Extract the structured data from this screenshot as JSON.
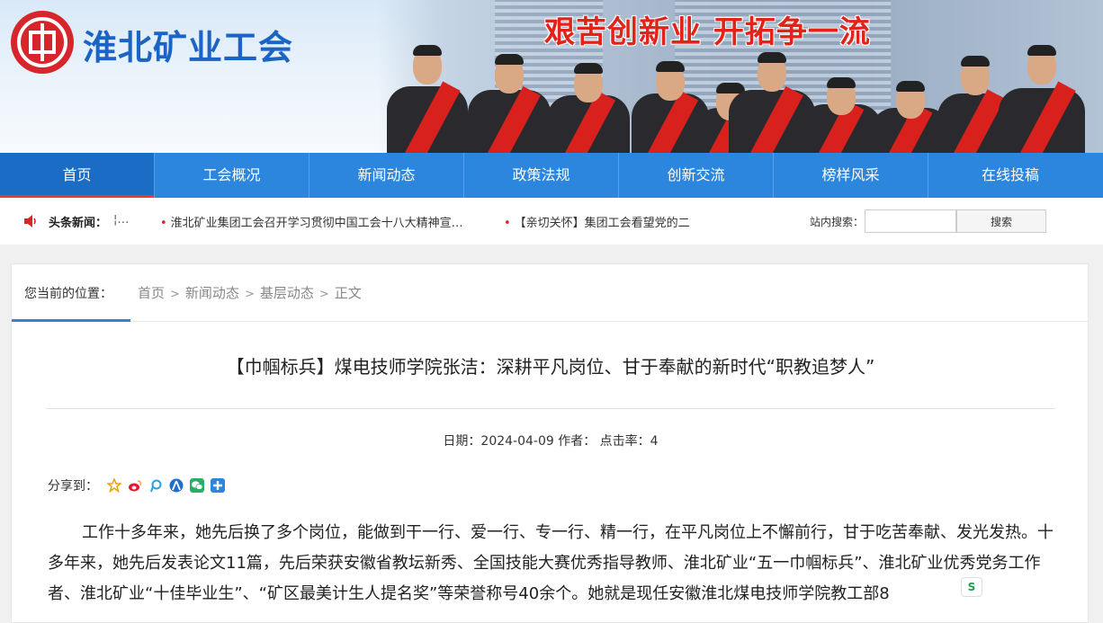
{
  "site": {
    "name": "淮北矿业工会",
    "slogan": "艰苦创新业 开拓争一流"
  },
  "nav": [
    {
      "label": "首页",
      "active": true
    },
    {
      "label": "工会概况",
      "active": false
    },
    {
      "label": "新闻动态",
      "active": false
    },
    {
      "label": "政策法规",
      "active": false
    },
    {
      "label": "创新交流",
      "active": false
    },
    {
      "label": "榜样风采",
      "active": false
    },
    {
      "label": "在线投稿",
      "active": false
    }
  ],
  "ticker": {
    "label": "头条新闻：",
    "dots": "¦…",
    "bullet": "•",
    "items": [
      "淮北矿业集团工会召开学习贯彻中国工会十八大精神宣…",
      "【亲切关怀】集团工会看望党的二"
    ]
  },
  "search": {
    "label": "站内搜索：",
    "value": "",
    "button": "搜索"
  },
  "breadcrumb": {
    "label": "您当前的位置：",
    "items": [
      "首页",
      "新闻动态",
      "基层动态",
      "正文"
    ],
    "separator": ">"
  },
  "article": {
    "title": "【巾帼标兵】煤电技师学院张洁：深耕平凡岗位、甘于奉献的新时代“职教追梦人”",
    "meta": "日期：2024-04-09 作者：  点击率：4",
    "share_label": "分享到：",
    "share_icons": [
      "qzone-icon",
      "weibo-icon",
      "tencent-weibo-icon",
      "renren-icon",
      "wechat-icon",
      "more-share-icon"
    ],
    "body": "工作十多年来，她先后换了多个岗位，能做到干一行、爱一行、专一行、精一行，在平凡岗位上不懈前行，甘于吃苦奉献、发光发热。十多年来，她先后发表论文11篇，先后荣获安徽省教坛新秀、全国技能大赛优秀指导教师、淮北矿业“五一巾帼标兵”、淮北矿业优秀党务工作者、淮北矿业“十佳毕业生”、“矿区最美计生人提名奖”等荣誉称号40余个。她就是现任安徽淮北煤电技师学院教工部8"
  },
  "float_badge": "S",
  "colors": {
    "nav_bg": "#2c86de",
    "nav_active": "#1a6cc4",
    "brand_red": "#d7262b",
    "brand_blue": "#1b63c4"
  }
}
